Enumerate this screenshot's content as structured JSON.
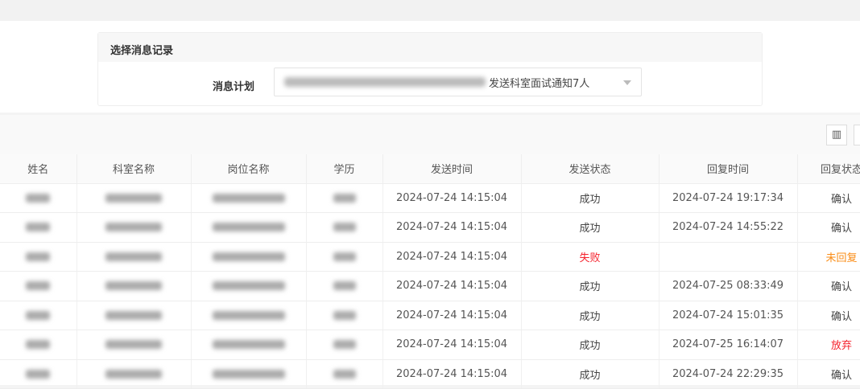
{
  "panel": {
    "title": "选择消息记录",
    "plan_label": "消息计划",
    "plan_value": "发送科室面试通知7人"
  },
  "toolbar": {
    "columns_icon": "column-settings-icon",
    "columns_glyph": "▥"
  },
  "table": {
    "headers": [
      "姓名",
      "科室名称",
      "岗位名称",
      "学历",
      "发送时间",
      "发送状态",
      "回复时间",
      "回复状态"
    ],
    "rows": [
      {
        "send_time": "2024-07-24 14:15:04",
        "send_status": "成功",
        "reply_time": "2024-07-24 19:17:34",
        "reply_status": "确认"
      },
      {
        "send_time": "2024-07-24 14:15:04",
        "send_status": "成功",
        "reply_time": "2024-07-24 14:55:22",
        "reply_status": "确认"
      },
      {
        "send_time": "2024-07-24 14:15:04",
        "send_status": "失败",
        "reply_time": "",
        "reply_status": "未回复"
      },
      {
        "send_time": "2024-07-24 14:15:04",
        "send_status": "成功",
        "reply_time": "2024-07-25 08:33:49",
        "reply_status": "确认"
      },
      {
        "send_time": "2024-07-24 14:15:04",
        "send_status": "成功",
        "reply_time": "2024-07-24 15:01:35",
        "reply_status": "确认"
      },
      {
        "send_time": "2024-07-24 14:15:04",
        "send_status": "成功",
        "reply_time": "2024-07-25 16:14:07",
        "reply_status": "放弃"
      },
      {
        "send_time": "2024-07-24 14:15:04",
        "send_status": "成功",
        "reply_time": "2024-07-24 22:29:35",
        "reply_status": "确认"
      }
    ]
  },
  "colors": {
    "失败": "#f5222d",
    "放弃": "#f5222d",
    "未回复": "#fa8c16",
    "default": "#333333"
  }
}
